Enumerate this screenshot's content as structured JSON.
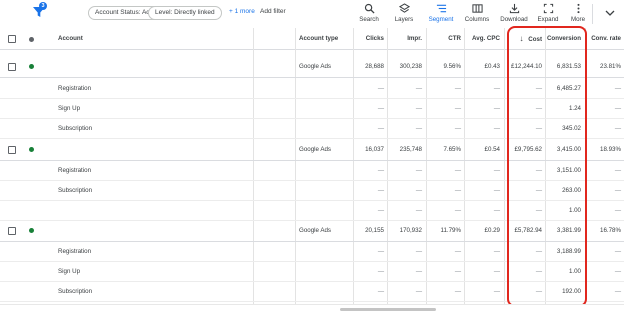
{
  "toolbar": {
    "filter_badge": "3",
    "chips": [
      "Account Status: Active",
      "Level: Directly linked"
    ],
    "more_filters": "+ 1 more",
    "add_filter": "Add filter",
    "tools": [
      {
        "label": "Search",
        "icon": "search-icon"
      },
      {
        "label": "Layers",
        "icon": "layers-icon"
      },
      {
        "label": "Segment",
        "icon": "segment-icon",
        "active": true
      },
      {
        "label": "Columns",
        "icon": "columns-icon"
      },
      {
        "label": "Download",
        "icon": "download-icon"
      },
      {
        "label": "Expand",
        "icon": "expand-icon"
      },
      {
        "label": "More",
        "icon": "more-vert-icon"
      }
    ]
  },
  "table": {
    "columns": {
      "account": "Account",
      "account_type": "Account type",
      "clicks": "Clicks",
      "impr": "Impr.",
      "ctr": "CTR",
      "avg_cpc": "Avg. CPC",
      "cost_sort_arrow": "↓",
      "cost": "Cost",
      "conversions": "Conversion",
      "conv_rate": "Conv. rate"
    },
    "rows": [
      {
        "kind": "account",
        "status_color": "#188038",
        "account_type": "Google Ads",
        "clicks": "28,688",
        "impr": "300,238",
        "ctr": "9.56%",
        "avg_cpc": "£0.43",
        "cost": "£12,244.10",
        "conversions": "6,831.53",
        "conv_rate": "23.81%"
      },
      {
        "kind": "segment",
        "label": "Registration",
        "clicks": "—",
        "impr": "—",
        "ctr": "—",
        "avg_cpc": "—",
        "cost": "—",
        "conversions": "6,485.27",
        "conv_rate": "—"
      },
      {
        "kind": "segment",
        "label": "Sign Up",
        "clicks": "—",
        "impr": "—",
        "ctr": "—",
        "avg_cpc": "—",
        "cost": "—",
        "conversions": "1.24",
        "conv_rate": "—"
      },
      {
        "kind": "segment",
        "label": "Subscription",
        "clicks": "—",
        "impr": "—",
        "ctr": "—",
        "avg_cpc": "—",
        "cost": "—",
        "conversions": "345.02",
        "conv_rate": "—"
      },
      {
        "kind": "account",
        "status_color": "#188038",
        "account_type": "Google Ads",
        "clicks": "16,037",
        "impr": "235,748",
        "ctr": "7.65%",
        "avg_cpc": "£0.54",
        "cost": "£9,795.62",
        "conversions": "3,415.00",
        "conv_rate": "18.93%"
      },
      {
        "kind": "segment",
        "label": "Registration",
        "clicks": "—",
        "impr": "—",
        "ctr": "—",
        "avg_cpc": "—",
        "cost": "—",
        "conversions": "3,151.00",
        "conv_rate": "—"
      },
      {
        "kind": "segment",
        "label": "Subscription",
        "clicks": "—",
        "impr": "—",
        "ctr": "—",
        "avg_cpc": "—",
        "cost": "—",
        "conversions": "263.00",
        "conv_rate": "—"
      },
      {
        "kind": "segment",
        "label": "",
        "clicks": "—",
        "impr": "—",
        "ctr": "—",
        "avg_cpc": "—",
        "cost": "—",
        "conversions": "1.00",
        "conv_rate": "—"
      },
      {
        "kind": "account",
        "status_color": "#188038",
        "account_type": "Google Ads",
        "clicks": "20,155",
        "impr": "170,932",
        "ctr": "11.79%",
        "avg_cpc": "£0.29",
        "cost": "£5,782.94",
        "conversions": "3,381.99",
        "conv_rate": "16.78%"
      },
      {
        "kind": "segment",
        "label": "Registration",
        "clicks": "—",
        "impr": "—",
        "ctr": "—",
        "avg_cpc": "—",
        "cost": "—",
        "conversions": "3,188.99",
        "conv_rate": "—"
      },
      {
        "kind": "segment",
        "label": "Sign Up",
        "clicks": "—",
        "impr": "—",
        "ctr": "—",
        "avg_cpc": "—",
        "cost": "—",
        "conversions": "1.00",
        "conv_rate": "—"
      },
      {
        "kind": "segment",
        "label": "Subscription",
        "clicks": "—",
        "impr": "—",
        "ctr": "—",
        "avg_cpc": "—",
        "cost": "—",
        "conversions": "192.00",
        "conv_rate": "—"
      }
    ]
  },
  "highlight_color": "#e1271e"
}
